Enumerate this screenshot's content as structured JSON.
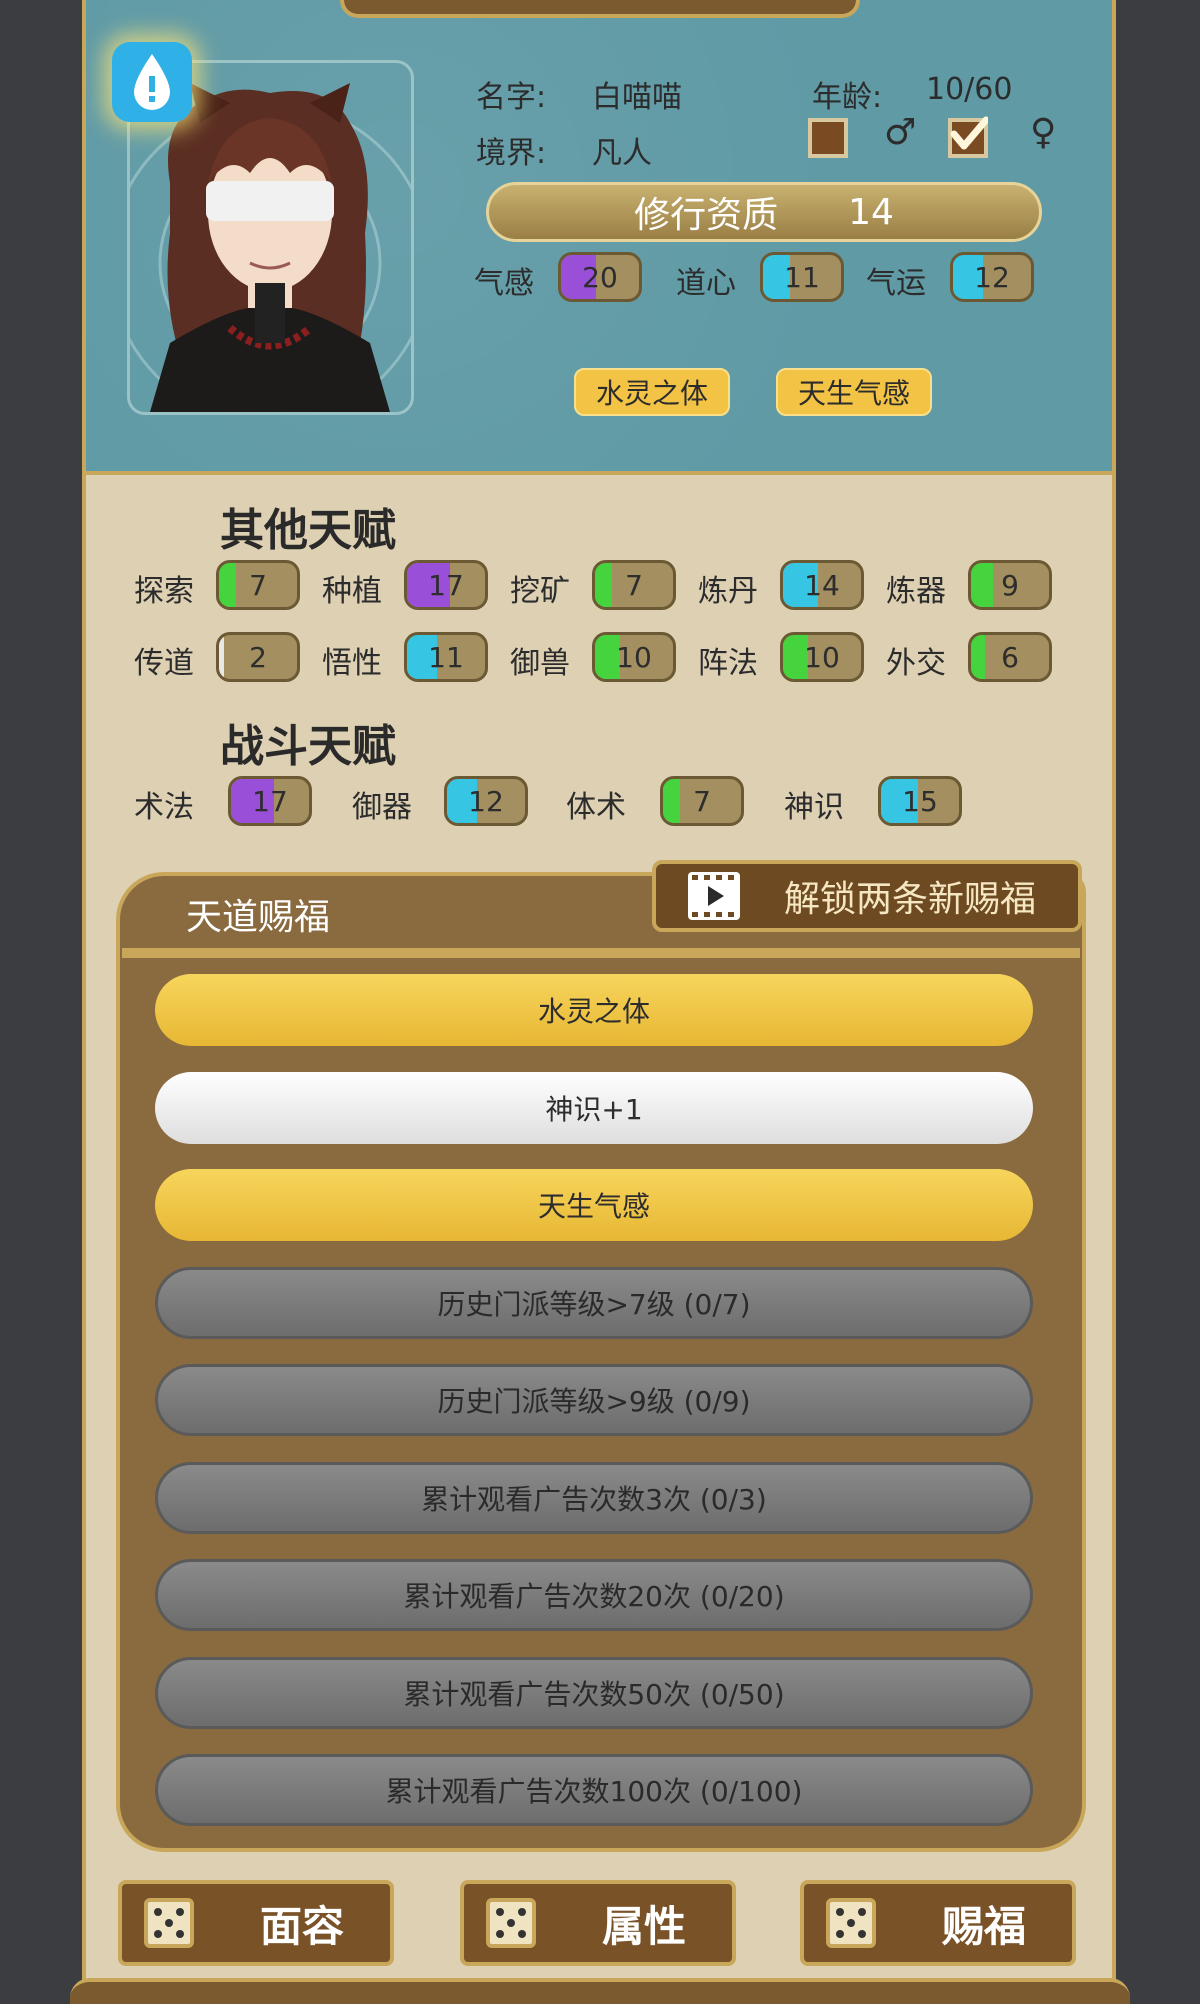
{
  "character": {
    "name_label": "名字:",
    "name": "白喵喵",
    "age_label": "年龄:",
    "age": "10/60",
    "realm_label": "境界:",
    "realm": "凡人",
    "gender_male_symbol": "♂",
    "gender_female_symbol": "♀",
    "gender_selected": "female",
    "aptitude_label": "修行资质",
    "aptitude_value": "14"
  },
  "base_stats": [
    {
      "label": "气感",
      "value": "20",
      "fill_pct": 45,
      "color": "#9a4fd8"
    },
    {
      "label": "道心",
      "value": "11",
      "fill_pct": 35,
      "color": "#36c6e3"
    },
    {
      "label": "气运",
      "value": "12",
      "fill_pct": 38,
      "color": "#36c6e3"
    }
  ],
  "traits": [
    "水灵之体",
    "天生气感"
  ],
  "other_talents": {
    "title": "其他天赋",
    "items": [
      {
        "label": "探索",
        "value": "7",
        "fill_pct": 22,
        "color": "#45d43e"
      },
      {
        "label": "种植",
        "value": "17",
        "fill_pct": 55,
        "color": "#9a4fd8"
      },
      {
        "label": "挖矿",
        "value": "7",
        "fill_pct": 22,
        "color": "#45d43e"
      },
      {
        "label": "炼丹",
        "value": "14",
        "fill_pct": 45,
        "color": "#36c6e3"
      },
      {
        "label": "炼器",
        "value": "9",
        "fill_pct": 28,
        "color": "#45d43e"
      },
      {
        "label": "传道",
        "value": "2",
        "fill_pct": 6,
        "color": "#e8e8e8"
      },
      {
        "label": "悟性",
        "value": "11",
        "fill_pct": 38,
        "color": "#36c6e3"
      },
      {
        "label": "御兽",
        "value": "10",
        "fill_pct": 32,
        "color": "#45d43e"
      },
      {
        "label": "阵法",
        "value": "10",
        "fill_pct": 32,
        "color": "#45d43e"
      },
      {
        "label": "外交",
        "value": "6",
        "fill_pct": 18,
        "color": "#45d43e"
      }
    ]
  },
  "combat_talents": {
    "title": "战斗天赋",
    "items": [
      {
        "label": "术法",
        "value": "17",
        "fill_pct": 55,
        "color": "#9a4fd8"
      },
      {
        "label": "御器",
        "value": "12",
        "fill_pct": 38,
        "color": "#36c6e3"
      },
      {
        "label": "体术",
        "value": "7",
        "fill_pct": 22,
        "color": "#45d43e"
      },
      {
        "label": "神识",
        "value": "15",
        "fill_pct": 48,
        "color": "#36c6e3"
      }
    ]
  },
  "blessings": {
    "title": "天道赐福",
    "unlock_label": "解锁两条新赐福",
    "items": [
      {
        "text": "水灵之体",
        "style": "gold"
      },
      {
        "text": "神识+1",
        "style": "white"
      },
      {
        "text": "天生气感",
        "style": "gold"
      },
      {
        "text": "历史门派等级>7级 (0/7)",
        "style": "gray"
      },
      {
        "text": "历史门派等级>9级 (0/9)",
        "style": "gray"
      },
      {
        "text": "累计观看广告次数3次 (0/3)",
        "style": "gray"
      },
      {
        "text": "累计观看广告次数20次 (0/20)",
        "style": "gray"
      },
      {
        "text": "累计观看广告次数50次 (0/50)",
        "style": "gray"
      },
      {
        "text": "累计观看广告次数100次 (0/100)",
        "style": "gray"
      }
    ]
  },
  "bottom_buttons": [
    "面容",
    "属性",
    "赐福"
  ],
  "colors": {
    "teal_panel": "#5f9aa5",
    "parchment": "#ddd0b3",
    "gold_trim": "#c9a75a",
    "brown_panel": "#8a6a3f"
  }
}
